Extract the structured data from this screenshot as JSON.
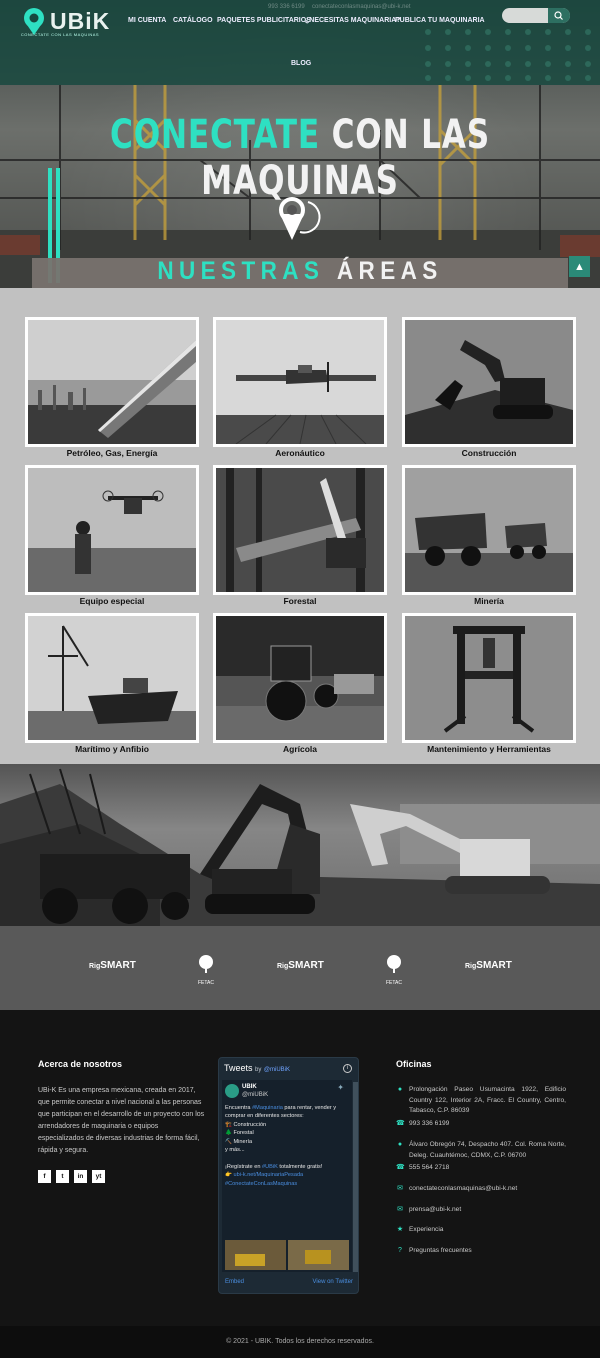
{
  "header": {
    "logo_text": "UBiK",
    "logo_tagline": "CONECTATE CON LAS MAQUINAS",
    "nav": [
      "MI CUENTA",
      "CATÁLOGO",
      "PAQUETES PUBLICITARIOS",
      "¿NECESITAS MAQUINARIA?",
      "PUBLICA TU MAQUINARIA",
      "BLOG"
    ],
    "phone_faint": "993 336 6199",
    "email_faint": "conectateconlasmaquinas@ubi-k.net"
  },
  "hero": {
    "title_accent": "CONECTATE",
    "title_rest": "CON LAS MAQUINAS",
    "areas_accent": "NUESTRAS",
    "areas_rest": "ÁREAS",
    "scroll_up_icon": "chevron-up-icon"
  },
  "areas": [
    {
      "label": "Petróleo, Gas, Energía"
    },
    {
      "label": "Aeronáutico"
    },
    {
      "label": "Construcción"
    },
    {
      "label": "Equipo especial"
    },
    {
      "label": "Forestal"
    },
    {
      "label": "Minería"
    },
    {
      "label": "Marítimo y Anfibio"
    },
    {
      "label": "Agrícola"
    },
    {
      "label": "Mantenimiento y Herramientas"
    }
  ],
  "partners": {
    "rigsmart_prefix": "Rig",
    "rigsmart_suffix": "SMART",
    "fetac": "FETAC"
  },
  "footer": {
    "about_title": "Acerca de nosotros",
    "about_text": "UBi-K Es una empresa mexicana, creada en 2017, que permite conectar a nivel nacional a las personas que participan en el desarrollo de un proyecto con los arrendadores de maquinaria o equipos especializados de diversas industrias de forma fácil, rápida y segura.",
    "social": [
      "f",
      "t",
      "in",
      "yt"
    ],
    "twitter": {
      "title": "Tweets",
      "by": "by",
      "by_handle": "@miUBiK",
      "name": "UBIK",
      "handle": "@miUBiK",
      "line1": "Encuentra",
      "hashtag1": "#Maquinaria",
      "line1b": " para rentar, vender y comprar en diferentes sectores:",
      "item1": "🏗️ Construcción",
      "item2": "🌲 Forestal",
      "item3": "⛏️ Minería",
      "more": "y más...",
      "cta_pre": "¡Regístrate en ",
      "cta_link": "#UBiK",
      "cta_post": " totalmente gratis!",
      "link_url": "👉 ubi-k.net/MaquinariaPesada",
      "link_tag": "#ConectateConLasMaquinas",
      "embed": "Embed",
      "view": "View on Twitter"
    },
    "offices_title": "Oficinas",
    "offices": [
      {
        "icon": "map-marker-icon",
        "text": "Prolongación Paseo Usumacinta 1922, Edificio Country 122, Interior 2A, Fracc. El Country, Centro, Tabasco, C.P. 86039"
      },
      {
        "icon": "phone-icon",
        "text": "993 336 6199"
      },
      {
        "icon": "map-marker-icon",
        "text": "Álvaro Obregón 74, Despacho 407. Col. Roma Norte, Deleg. Cuauhtémoc, CDMX, C.P. 06700"
      },
      {
        "icon": "phone-icon",
        "text": "555 564 2718"
      },
      {
        "icon": "envelope-icon",
        "text": "conectateconlasmaquinas@ubi-k.net"
      },
      {
        "icon": "envelope-icon",
        "text": "prensa@ubi-k.net"
      },
      {
        "icon": "star-icon",
        "text": "Experiencia"
      },
      {
        "icon": "question-icon",
        "text": "Preguntas frecuentes"
      }
    ],
    "copyright": "© 2021 - UBIK. Todos los derechos reservados."
  },
  "colors": {
    "accent": "#2ee0c2",
    "header_bg": "#16483e",
    "band": "#78726e",
    "grid_bg": "#c1c1c1",
    "footer_bg": "#141414"
  }
}
